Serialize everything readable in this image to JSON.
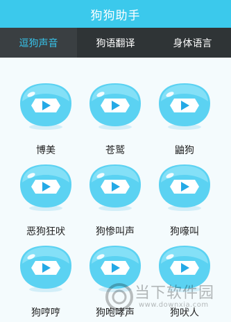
{
  "header": {
    "title": "狗狗助手"
  },
  "tabs": [
    {
      "label": "逗狗声音",
      "active": true
    },
    {
      "label": "狗语翻译",
      "active": false
    },
    {
      "label": "身体语言",
      "active": false
    }
  ],
  "sounds": [
    {
      "label": "博美"
    },
    {
      "label": "苍鹫"
    },
    {
      "label": "鼬狗"
    },
    {
      "label": "恶狗狂吠"
    },
    {
      "label": "狗惨叫声"
    },
    {
      "label": "狗嚎叫"
    },
    {
      "label": "狗哼哼"
    },
    {
      "label": "狗咆哮声"
    },
    {
      "label": "狗吠人"
    }
  ],
  "watermark": {
    "text": "当下软件园",
    "url": "www.downxia.com"
  },
  "colors": {
    "header": "#3bc9ec",
    "tabbar": "#2f3436",
    "active_tab": "#37c3ea",
    "bubble": "#5bd2f2",
    "play": "#24a9e6"
  }
}
